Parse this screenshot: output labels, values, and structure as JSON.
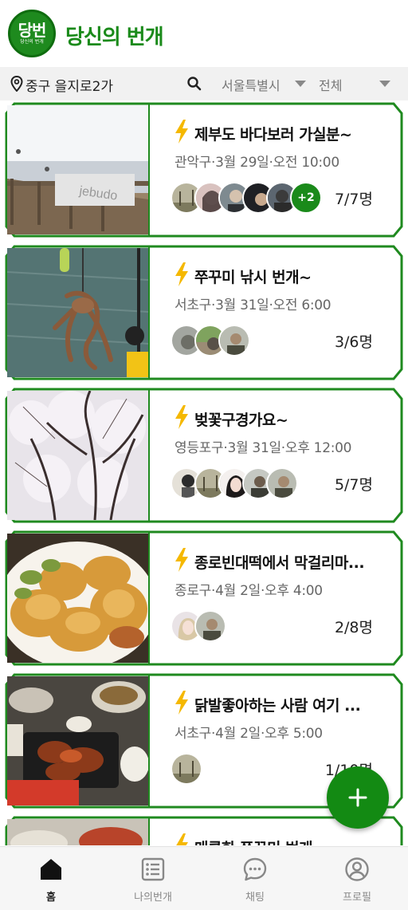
{
  "header": {
    "logo_main": "당번",
    "logo_sub": "당신의 번개",
    "title": "당신의 번개"
  },
  "filters": {
    "location": "중구 을지로2가",
    "region": "서울특별시",
    "type": "전체"
  },
  "icons": {
    "location": "location-pin-icon",
    "search": "search-icon",
    "lightning": "lightning-icon",
    "add": "plus-icon"
  },
  "colors": {
    "brand": "#1a8a1a",
    "bolt": "#f5b800"
  },
  "meetups": [
    {
      "title": "제부도 바다보러 가실분~",
      "meta": "관악구·3월 29일·오전 10:00",
      "extra_members": "+2",
      "count": "7/7명"
    },
    {
      "title": "쭈꾸미 낚시 번개~",
      "meta": "서초구·3월 31일·오전 6:00",
      "count": "3/6명"
    },
    {
      "title": "벚꽃구경가요~",
      "meta": "영등포구·3월 31일·오후 12:00",
      "count": "5/7명"
    },
    {
      "title": "종로빈대떡에서 막걸리마...",
      "meta": "종로구·4월 2일·오후 4:00",
      "count": "2/8명"
    },
    {
      "title": "닭발좋아하는 사람 여기 ...",
      "meta": "서초구·4월 2일·오후 5:00",
      "count": "1/10명"
    },
    {
      "title": "매콤한 쭈꾸미 번개"
    }
  ],
  "nav": {
    "home": "홈",
    "my_meetups": "나의번개",
    "chat": "채팅",
    "profile": "프로필"
  }
}
